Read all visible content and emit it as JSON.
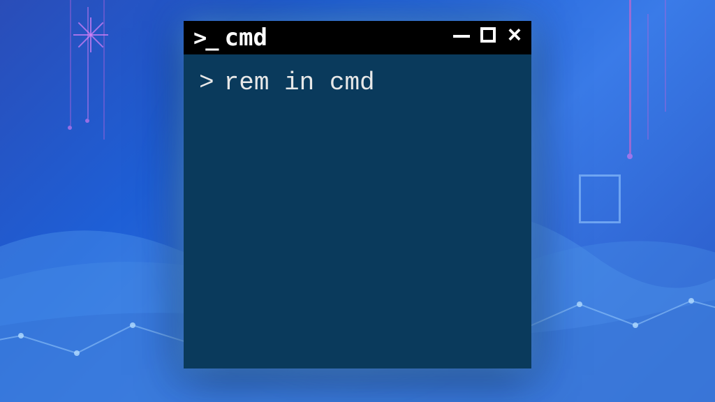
{
  "window": {
    "title": "cmd",
    "icon_prompt": ">_"
  },
  "terminal": {
    "prompt": ">",
    "command": "rem in cmd"
  },
  "controls": {
    "minimize": "−",
    "maximize": "□",
    "close": "×"
  },
  "colors": {
    "terminal_bg": "#0a3a5c",
    "titlebar_bg": "#000000",
    "text": "#e8e8e8"
  }
}
